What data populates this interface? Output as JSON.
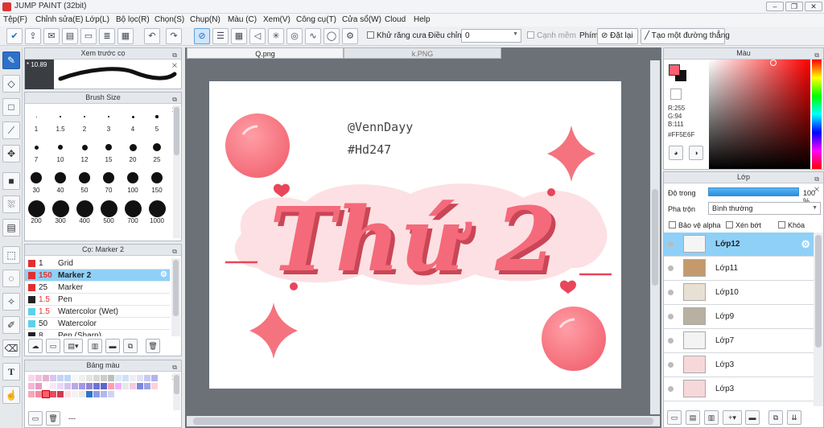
{
  "app": {
    "title": "JUMP PAINT (32bit)"
  },
  "menu": [
    "Tệp(F)",
    "Chỉnh sửa(E)",
    "Lớp(L)",
    "Bộ lọc(R)",
    "Chọn(S)",
    "Chụp(N)",
    "Màu (C)",
    "Xem(V)",
    "Công cụ(T)",
    "Cửa sổ(W)",
    "Cloud",
    "Help"
  ],
  "toolbar": {
    "antialias_label": "Khử răng cưa",
    "adjust_label": "Điều chỉnh",
    "adjust_value": "0",
    "smooth_label": "Cạnh mềm",
    "key_label": "Phím",
    "reset_label": "Đặt lại",
    "straight_label": "Tạo một đường thẳng"
  },
  "preview": {
    "title": "Xem trước cọ",
    "size": "10.89"
  },
  "brush_size": {
    "title": "Brush Size",
    "sizes": [
      "1",
      "1.5",
      "2",
      "3",
      "4",
      "5",
      "7",
      "10",
      "12",
      "15",
      "20",
      "25",
      "30",
      "40",
      "50",
      "70",
      "100",
      "150",
      "200",
      "300",
      "400",
      "500",
      "700",
      "1000"
    ]
  },
  "brush_list": {
    "title": "Cọ: Marker 2",
    "items": [
      {
        "num": "1",
        "name": "Grid",
        "color": "#e03030",
        "numcolor": "#222"
      },
      {
        "num": "150",
        "name": "Marker 2",
        "color": "#e03030",
        "numcolor": "#e03030"
      },
      {
        "num": "25",
        "name": "Marker",
        "color": "#e03030",
        "numcolor": "#222"
      },
      {
        "num": "1.5",
        "name": "Pen",
        "color": "#222222",
        "numcolor": "#e03030"
      },
      {
        "num": "1.5",
        "name": "Watercolor (Wet)",
        "color": "#5fd0e8",
        "numcolor": "#e03030"
      },
      {
        "num": "50",
        "name": "Watercolor",
        "color": "#5fd0e8",
        "numcolor": "#222"
      },
      {
        "num": "8",
        "name": "Pen (Sharp)",
        "color": "#222222",
        "numcolor": "#222"
      }
    ]
  },
  "palette": {
    "title": "Bảng màu",
    "footer": "---"
  },
  "tabs": [
    "Q.png",
    "k.PNG"
  ],
  "canvas": {
    "handle": "@VennDayy",
    "tag": "#Hd247",
    "lettering": "Thứ 2"
  },
  "color_panel": {
    "title": "Màu",
    "r": "R:255",
    "g": "G:94",
    "b": "B:111",
    "hex": "#FF5E6F",
    "fg": "#ff5e6f"
  },
  "layer_panel": {
    "title": "Lớp",
    "opacity_label": "Độ trong",
    "opacity_value": "100 %",
    "blend_label": "Pha trộn",
    "blend_value": "Bình thường",
    "protect_alpha": "Bảo vệ alpha",
    "clip": "Xén bớt",
    "lock": "Khóa",
    "layers": [
      {
        "name": "Lớp12",
        "thumb": "#f5f5f5"
      },
      {
        "name": "Lớp11",
        "thumb": "#c49a6c"
      },
      {
        "name": "Lớp10",
        "thumb": "#e8e0d2"
      },
      {
        "name": "Lớp9",
        "thumb": "#b8b0a0"
      },
      {
        "name": "Lớp7",
        "thumb": "#f3f3f3"
      },
      {
        "name": "Lớp3",
        "thumb": "#f7d8da"
      },
      {
        "name": "Lớp3",
        "thumb": "#f7d8da"
      }
    ]
  },
  "colors": {
    "accent": "#2d72c8",
    "selection": "#8fd0f7",
    "pink": "#ff5e6f"
  }
}
